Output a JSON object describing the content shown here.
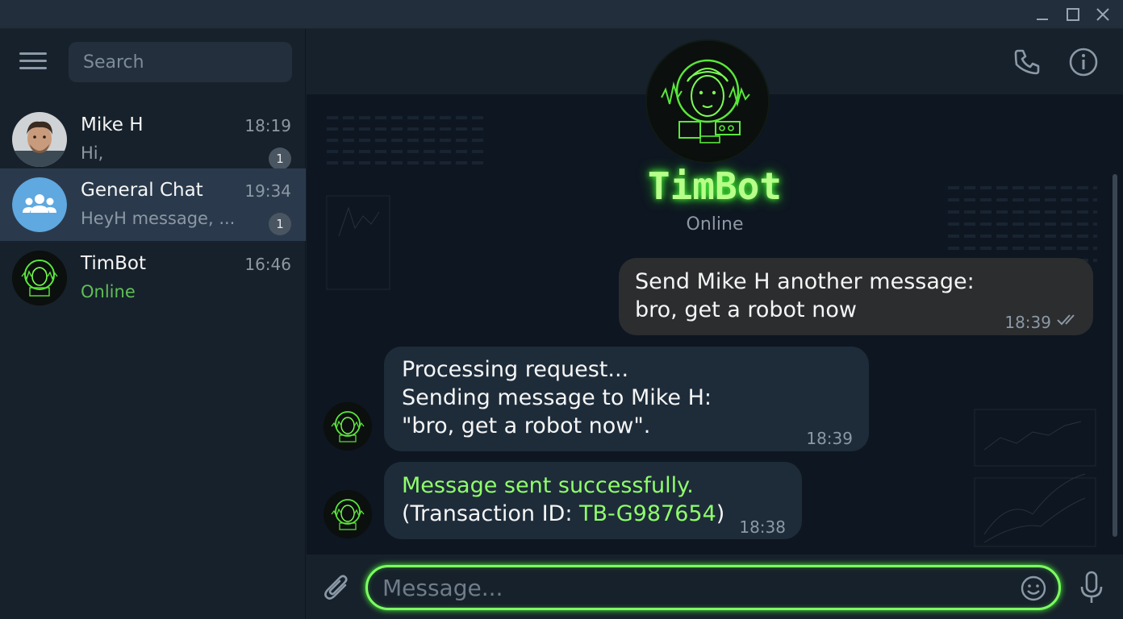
{
  "window": {
    "controls": [
      "minimize-icon",
      "maximize-icon",
      "close-icon"
    ]
  },
  "sidebar": {
    "search_placeholder": "Search",
    "chats": [
      {
        "name": "Mike H",
        "time": "18:19",
        "preview": "Hi,",
        "unread": "1"
      },
      {
        "name": "General Chat",
        "time": "19:34",
        "preview": "HeyH message, ...",
        "unread": "1"
      },
      {
        "name": "TimBot",
        "time": "16:46",
        "preview": "Online"
      }
    ]
  },
  "header": {
    "icons": [
      "phone-icon",
      "info-icon"
    ]
  },
  "chat": {
    "title": "TimBot",
    "status": "Online",
    "messages": [
      {
        "direction": "outgoing",
        "lines": [
          "Send Mike H another message:",
          "bro, get a robot now"
        ],
        "time": "18:39"
      },
      {
        "direction": "incoming",
        "lines": [
          "Processing request...",
          "Sending message to Mike H:",
          "\"bro, get a robot now\"."
        ],
        "time": "18:39"
      },
      {
        "direction": "incoming",
        "line1": "Message sent successfully.",
        "line2_prefix": "(Transaction ID: ",
        "transaction_id": "TB-G987654",
        "line2_suffix": ")",
        "time": "18:38"
      }
    ]
  },
  "composer": {
    "placeholder": "Message..."
  },
  "colors": {
    "accent_green": "#8fff6a",
    "online_green": "#5fbf57",
    "sidebar_bg": "#17212b",
    "chat_bg": "#0e1621"
  }
}
